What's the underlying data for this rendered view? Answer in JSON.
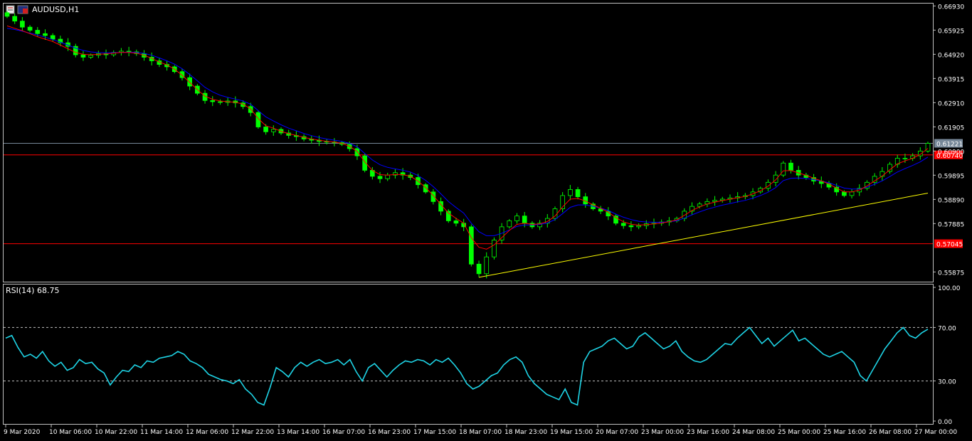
{
  "window": {
    "symbol_title": "AUDUSD,H1",
    "rsi_title": "RSI(14) 68.75"
  },
  "colors": {
    "background": "#000000",
    "frame": "#c0c0c0",
    "grid_text": "#ffffff",
    "candle_up": "#00ff00",
    "candle_down": "#00ff00",
    "ma_fast": "#ff0000",
    "ma_slow": "#0000ff",
    "trendline": "#ffff00",
    "level_line": "#ff0000",
    "bid_line": "#778899",
    "rsi_line": "#1ed4e6",
    "rsi_level": "#c0c0c0"
  },
  "chart_data": [
    {
      "type": "candlestick",
      "symbol": "AUDUSD",
      "timeframe": "H1",
      "title": "AUDUSD,H1",
      "ylim": [
        0.555,
        0.67
      ],
      "y_ticks": [
        "0.66930",
        "0.65925",
        "0.64920",
        "0.63915",
        "0.62910",
        "0.61905",
        "0.60900",
        "0.59895",
        "0.58890",
        "0.57885",
        "0.55875"
      ],
      "x_ticks": [
        "9 Mar 2020",
        "10 Mar 06:00",
        "10 Mar 22:00",
        "11 Mar 14:00",
        "12 Mar 06:00",
        "12 Mar 22:00",
        "13 Mar 14:00",
        "16 Mar 07:00",
        "16 Mar 23:00",
        "17 Mar 15:00",
        "18 Mar 07:00",
        "18 Mar 23:00",
        "19 Mar 15:00",
        "20 Mar 07:00",
        "23 Mar 00:00",
        "23 Mar 16:00",
        "24 Mar 08:00",
        "25 Mar 00:00",
        "25 Mar 16:00",
        "26 Mar 08:00",
        "27 Mar 00:00"
      ],
      "close_series": [
        0.665,
        0.663,
        0.6605,
        0.6592,
        0.6578,
        0.657,
        0.6555,
        0.654,
        0.6525,
        0.649,
        0.648,
        0.6488,
        0.6495,
        0.649,
        0.65,
        0.6505,
        0.6502,
        0.6495,
        0.648,
        0.6465,
        0.645,
        0.644,
        0.642,
        0.6395,
        0.636,
        0.633,
        0.63,
        0.6295,
        0.6292,
        0.6298,
        0.629,
        0.6275,
        0.625,
        0.619,
        0.617,
        0.618,
        0.6165,
        0.6155,
        0.615,
        0.614,
        0.6135,
        0.613,
        0.6128,
        0.6125,
        0.6118,
        0.61,
        0.607,
        0.601,
        0.5985,
        0.5975,
        0.599,
        0.6,
        0.599,
        0.598,
        0.595,
        0.592,
        0.588,
        0.584,
        0.58,
        0.579,
        0.5775,
        0.562,
        0.558,
        0.565,
        0.572,
        0.5775,
        0.58,
        0.582,
        0.579,
        0.5775,
        0.579,
        0.581,
        0.585,
        0.5905,
        0.593,
        0.59,
        0.587,
        0.585,
        0.584,
        0.582,
        0.579,
        0.578,
        0.5775,
        0.578,
        0.5788,
        0.579,
        0.5795,
        0.58,
        0.581,
        0.584,
        0.586,
        0.587,
        0.588,
        0.5885,
        0.589,
        0.5895,
        0.59,
        0.5905,
        0.592,
        0.5935,
        0.596,
        0.599,
        0.604,
        0.601,
        0.599,
        0.598,
        0.5965,
        0.5955,
        0.594,
        0.592,
        0.5905,
        0.592,
        0.5935,
        0.596,
        0.5985,
        0.6005,
        0.6035,
        0.606,
        0.606,
        0.607,
        0.609,
        0.6122
      ],
      "ma_fast_series": [
        0.661,
        0.66,
        0.659,
        0.6578,
        0.6565,
        0.6555,
        0.6545,
        0.653,
        0.6515,
        0.65,
        0.6492,
        0.649,
        0.6492,
        0.6494,
        0.6497,
        0.65,
        0.65,
        0.6497,
        0.6488,
        0.6475,
        0.646,
        0.6448,
        0.643,
        0.6405,
        0.6375,
        0.6345,
        0.6318,
        0.6305,
        0.6298,
        0.6295,
        0.6293,
        0.6285,
        0.6265,
        0.6225,
        0.6195,
        0.6185,
        0.6172,
        0.6162,
        0.6155,
        0.6147,
        0.614,
        0.6135,
        0.613,
        0.6127,
        0.6122,
        0.611,
        0.6088,
        0.6045,
        0.601,
        0.5992,
        0.599,
        0.5993,
        0.5992,
        0.5985,
        0.5965,
        0.5938,
        0.5905,
        0.5868,
        0.5832,
        0.581,
        0.579,
        0.573,
        0.569,
        0.5682,
        0.57,
        0.573,
        0.576,
        0.5785,
        0.579,
        0.5785,
        0.5787,
        0.5797,
        0.582,
        0.5858,
        0.589,
        0.5893,
        0.5882,
        0.5866,
        0.5852,
        0.5836,
        0.5813,
        0.5796,
        0.5786,
        0.5782,
        0.5784,
        0.5787,
        0.5791,
        0.5796,
        0.5804,
        0.5823,
        0.5843,
        0.5858,
        0.587,
        0.5878,
        0.5884,
        0.589,
        0.5896,
        0.5901,
        0.5912,
        0.5925,
        0.5944,
        0.597,
        0.6008,
        0.6009,
        0.5999,
        0.5989,
        0.5977,
        0.5966,
        0.5953,
        0.5936,
        0.592,
        0.592,
        0.5928,
        0.5945,
        0.5966,
        0.5986,
        0.6012,
        0.6037,
        0.6049,
        0.606,
        0.6076,
        0.6101
      ],
      "ma_slow_series": [
        0.66,
        0.6595,
        0.6588,
        0.658,
        0.6572,
        0.6563,
        0.6553,
        0.6542,
        0.653,
        0.6518,
        0.6508,
        0.6502,
        0.6499,
        0.6498,
        0.6499,
        0.65,
        0.6501,
        0.65,
        0.6496,
        0.6488,
        0.6477,
        0.6465,
        0.6451,
        0.6432,
        0.6408,
        0.6382,
        0.6355,
        0.6336,
        0.6322,
        0.6313,
        0.6306,
        0.6298,
        0.6285,
        0.6258,
        0.6232,
        0.6215,
        0.6199,
        0.6185,
        0.6174,
        0.6163,
        0.6154,
        0.6146,
        0.614,
        0.6135,
        0.613,
        0.6122,
        0.6108,
        0.608,
        0.6053,
        0.6033,
        0.6022,
        0.6016,
        0.601,
        0.6003,
        0.5988,
        0.5968,
        0.5942,
        0.5912,
        0.588,
        0.5855,
        0.5832,
        0.579,
        0.5755,
        0.5738,
        0.5738,
        0.5748,
        0.5762,
        0.5777,
        0.5783,
        0.5783,
        0.5785,
        0.5791,
        0.5805,
        0.583,
        0.5856,
        0.5866,
        0.5866,
        0.586,
        0.5853,
        0.5843,
        0.5828,
        0.5815,
        0.5805,
        0.5798,
        0.5795,
        0.5794,
        0.5794,
        0.5796,
        0.58,
        0.5811,
        0.5825,
        0.5837,
        0.5848,
        0.5857,
        0.5865,
        0.5872,
        0.5879,
        0.5885,
        0.5894,
        0.5905,
        0.5919,
        0.5938,
        0.5967,
        0.5977,
        0.5978,
        0.5976,
        0.5971,
        0.5965,
        0.5958,
        0.5947,
        0.5936,
        0.5932,
        0.5932,
        0.594,
        0.5952,
        0.5966,
        0.5984,
        0.6003,
        0.6017,
        0.603,
        0.6045,
        0.6065
      ],
      "horizontal_levels": [
        {
          "name": "resistance",
          "value": 0.6074,
          "label": "0.60740",
          "color": "#ff0000"
        },
        {
          "name": "support",
          "value": 0.5705,
          "label": "0.57045",
          "color": "#ff0000"
        }
      ],
      "bid": {
        "value": 0.61221,
        "label": "0.61221"
      },
      "trendline": {
        "from": {
          "index": 62,
          "value": 0.5565
        },
        "to": {
          "index": 121,
          "value": 0.5915
        }
      }
    },
    {
      "type": "line",
      "title": "RSI(14) 68.75",
      "name": "RSI(14)",
      "ylim": [
        0,
        100
      ],
      "y_ticks": [
        "100.00",
        "70.00",
        "30.00",
        "0.00"
      ],
      "levels": [
        70,
        30
      ],
      "values": [
        62,
        64,
        55,
        48,
        50,
        47,
        52,
        45,
        41,
        44,
        38,
        40,
        46,
        43,
        44,
        39,
        36,
        27,
        33,
        38,
        37,
        42,
        40,
        45,
        44,
        47,
        48,
        49,
        52,
        50,
        45,
        43,
        40,
        35,
        33,
        31,
        30,
        28,
        31,
        24,
        20,
        14,
        12,
        25,
        40,
        37,
        33,
        40,
        44,
        41,
        44,
        46,
        43,
        44,
        46,
        42,
        46,
        37,
        30,
        40,
        43,
        38,
        33,
        38,
        42,
        45,
        44,
        46,
        45,
        42,
        46,
        44,
        47,
        42,
        36,
        28,
        24,
        26,
        30,
        34,
        36,
        42,
        46,
        48,
        44,
        34,
        28,
        24,
        20,
        18,
        16,
        24,
        14,
        12,
        44,
        52,
        54,
        56,
        60,
        62,
        58,
        54,
        56,
        63,
        66,
        62,
        58,
        54,
        56,
        60,
        52,
        48,
        45,
        44,
        46,
        50,
        54,
        58,
        57,
        62,
        66,
        70,
        64,
        58,
        62,
        56,
        60,
        64,
        68,
        60,
        62,
        58,
        54,
        50,
        48,
        50,
        52,
        48,
        44,
        34,
        30,
        38,
        46,
        54,
        60,
        66,
        70,
        64,
        62,
        66,
        68.75
      ]
    }
  ]
}
